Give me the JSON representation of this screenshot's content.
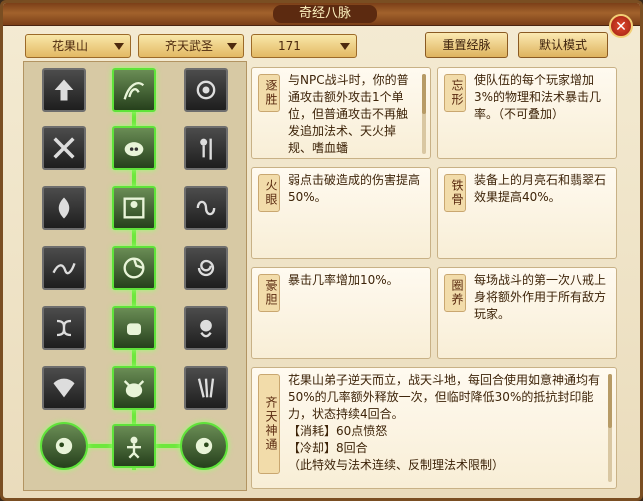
{
  "window": {
    "title": "奇经八脉"
  },
  "filters": {
    "faction": "花果山",
    "school": "齐天武圣",
    "level": "171"
  },
  "buttons": {
    "reset": "重置经脉",
    "default": "默认模式"
  },
  "icons": {
    "row1": [
      "up-arrow-icon",
      "vine-swirl-icon",
      "spiral-figure-icon"
    ],
    "row2": [
      "crossed-arms-icon",
      "pig-face-icon",
      "figure-staff-icon"
    ],
    "row3": [
      "flame-mask-icon",
      "split-figure-icon",
      "twin-swirl-icon"
    ],
    "row4": [
      "wave-icon",
      "ring-spin-icon",
      "spiral-orb-icon"
    ],
    "row5": [
      "knot-icon",
      "punch-icon",
      "monkey-icon"
    ],
    "row6": [
      "fan-icon",
      "ox-icon",
      "claw-icon"
    ],
    "row7": [
      "orb-left-icon",
      "monkey-king-icon",
      "orb-right-icon"
    ]
  },
  "skills": [
    {
      "name": "逐胜",
      "text": "与NPC战斗时，你的普通攻击额外攻击1个单位，但普通攻击不再触发追加法术、天火掉规、嗜血蟠"
    },
    {
      "name": "忘形",
      "text": "使队伍的每个玩家增加3%的物理和法术暴击几率。（不可叠加）"
    },
    {
      "name": "火眼",
      "text": "弱点击破造成的伤害提高50%。"
    },
    {
      "name": "铁骨",
      "text": "装备上的月亮石和翡翠石效果提高40%。"
    },
    {
      "name": "豪胆",
      "text": "暴击几率增加10%。"
    },
    {
      "name": "圈养",
      "text": "每场战斗的第一次八戒上身将额外作用于所有敌方玩家。"
    },
    {
      "name": "齐天神通",
      "text": "花果山弟子逆天而立，战天斗地，每回合使用如意神通均有50%的几率额外释放一次，但临时降低30%的抵抗封印能力，状态持续4回合。",
      "cost_label": "【消耗】60点愤怒",
      "cd_label": "【冷却】8回合",
      "extra": "（此特效与法术连续、反制理法术限制）"
    }
  ],
  "colors": {
    "accent": "#6de83c",
    "frame": "#7a4e22",
    "panel": "#f4ebd3"
  }
}
